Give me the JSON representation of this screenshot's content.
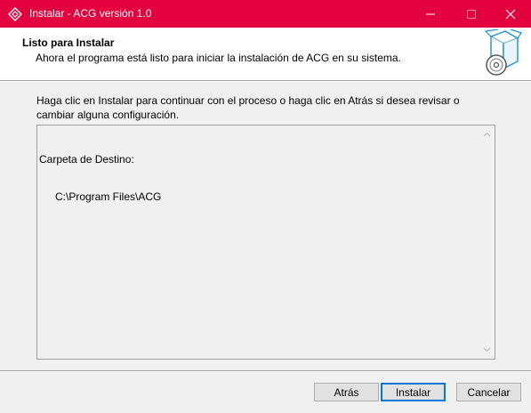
{
  "window": {
    "title": "Instalar - ACG versión 1.0",
    "accent_color": "#e3003e",
    "controls": [
      "minimize-icon",
      "maximize-icon",
      "close-icon"
    ]
  },
  "header": {
    "title": "Listo para Instalar",
    "subtitle": "Ahora el programa está listo para iniciar la instalación de ACG en su sistema.",
    "graphic": "install-box-disc-icon"
  },
  "body": {
    "description": "Haga clic en Instalar para continuar con el proceso o haga clic en Atrás si desea revisar o cambiar alguna configuración.",
    "details": {
      "label": "Carpeta de Destino:",
      "value": "C:\\Program Files\\ACG"
    }
  },
  "buttons": {
    "back": "Atrás",
    "install": "Instalar",
    "cancel": "Cancelar"
  }
}
